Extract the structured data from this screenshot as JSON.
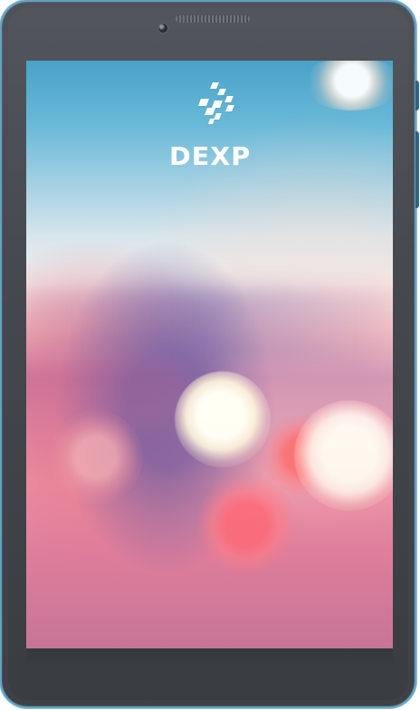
{
  "device": {
    "brand": "DEXP"
  },
  "colors": {
    "frame_accent": "#5fa3c6",
    "bezel": "#44484e",
    "screen_sky": "#65b7d7",
    "screen_pink": "#ef92a6",
    "bokeh_white": "#fff8ef",
    "bokeh_pink": "#ff6f7c"
  },
  "icons": {
    "logo": "dexp-logo-icon",
    "camera": "camera-icon",
    "speaker": "speaker-icon"
  }
}
